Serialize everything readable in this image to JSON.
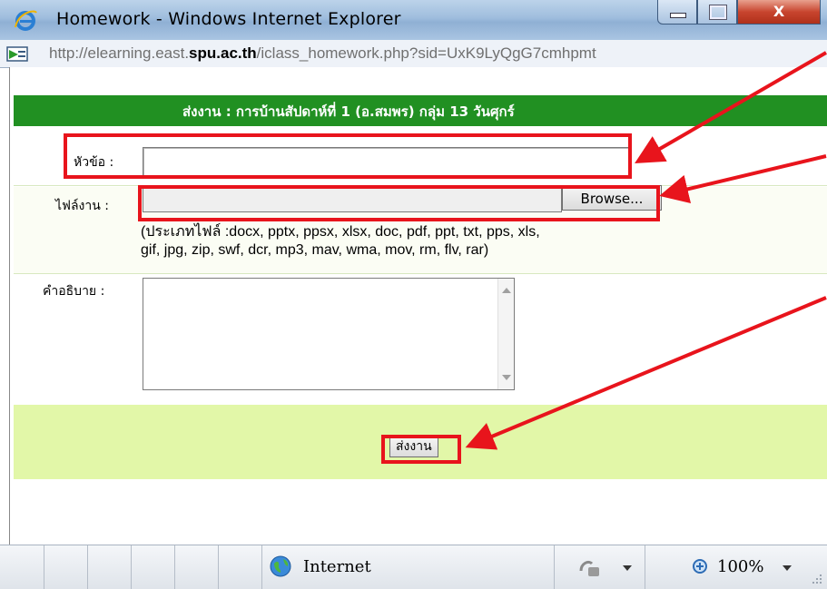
{
  "window": {
    "title": "Homework - Windows Internet Explorer",
    "close_glyph": "X"
  },
  "address": {
    "url_prefix": "http://elearning.east.",
    "url_domain": "spu.ac.th",
    "url_suffix": "/iclass_homework.php?sid=UxK9LyQgG7cmhpmt"
  },
  "form": {
    "header": "ส่งงาน : การบ้านสัปดาห์ที่ 1 (อ.สมพร) กลุ่ม 13 วันศุกร์",
    "subject_label": "หัวข้อ :",
    "subject_value": "",
    "file_label": "ไฟล์งาน :",
    "browse_label": "Browse...",
    "file_types_line1": "(ประเภทไฟล์ :docx, pptx, ppsx, xlsx, doc, pdf, ppt, txt, pps, xls,",
    "file_types_line2": "gif, jpg, zip, swf, dcr, mp3, mav, wma, mov, rm, flv, rar)",
    "description_label": "คำอธิบาย :",
    "description_value": "",
    "submit_label": "ส่งงาน"
  },
  "statusbar": {
    "zone": "Internet",
    "zoom": "100%"
  },
  "colors": {
    "header_green": "#219022",
    "submit_row": "#e2f7a8",
    "annotation_red": "#e8141c"
  }
}
